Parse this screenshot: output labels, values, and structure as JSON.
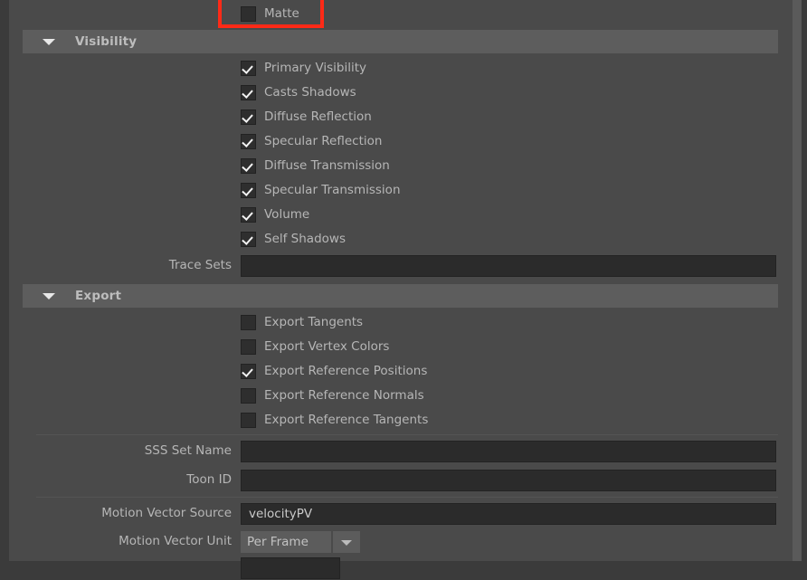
{
  "top_row": {
    "label": "Matte",
    "checked": false,
    "highlight_color": "#ff2a17"
  },
  "sections": [
    {
      "name": "visibility",
      "title": "Visibility",
      "expanded": true,
      "collapse_icon": "triangle-down-icon"
    },
    {
      "name": "export",
      "title": "Export",
      "expanded": true,
      "collapse_icon": "triangle-down-icon"
    }
  ],
  "visibility_checkboxes": [
    {
      "label": "Primary Visibility",
      "checked": true
    },
    {
      "label": "Casts Shadows",
      "checked": true
    },
    {
      "label": "Diffuse Reflection",
      "checked": true
    },
    {
      "label": "Specular Reflection",
      "checked": true
    },
    {
      "label": "Diffuse Transmission",
      "checked": true
    },
    {
      "label": "Specular Transmission",
      "checked": true
    },
    {
      "label": "Volume",
      "checked": true
    },
    {
      "label": "Self Shadows",
      "checked": true
    }
  ],
  "trace_sets": {
    "label": "Trace Sets",
    "value": "",
    "placeholder": ""
  },
  "export_checkboxes": [
    {
      "label": "Export Tangents",
      "checked": false
    },
    {
      "label": "Export Vertex Colors",
      "checked": false
    },
    {
      "label": "Export Reference Positions",
      "checked": true
    },
    {
      "label": "Export Reference Normals",
      "checked": false
    },
    {
      "label": "Export Reference Tangents",
      "checked": false
    }
  ],
  "fields": [
    {
      "name": "sss-set-name",
      "label": "SSS Set Name",
      "value": ""
    },
    {
      "name": "toon-id",
      "label": "Toon ID",
      "value": ""
    },
    {
      "name": "motion-vector-source",
      "label": "Motion Vector Source",
      "value": "velocityPV"
    }
  ],
  "motion_vector_unit": {
    "label": "Motion Vector Unit",
    "value": "Per Frame",
    "dropdown_icon": "chevron-down-icon"
  },
  "colors": {
    "panel_bg": "#4a4a4a",
    "section_header_bg": "#5d5d5d",
    "field_bg": "#2b2b2b",
    "label_text": "#b6b6b6",
    "highlight": "#ff2a17"
  }
}
